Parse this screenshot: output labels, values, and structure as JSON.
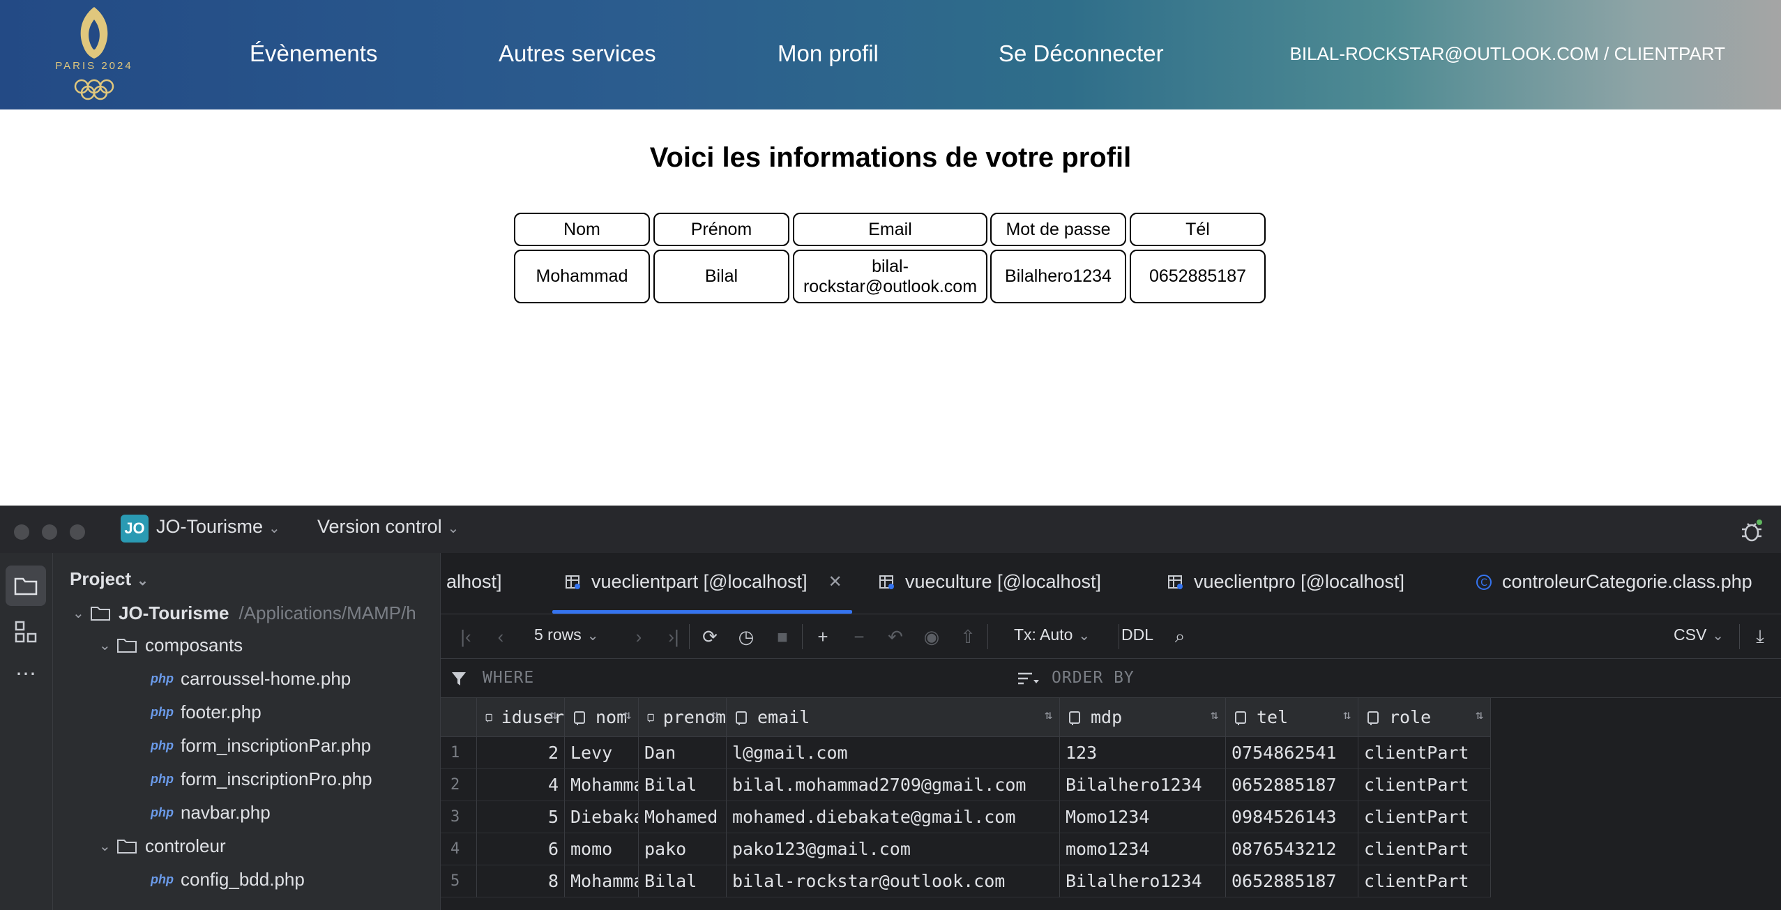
{
  "site": {
    "logo_text": "PARIS 2024",
    "nav": [
      {
        "label": "Évènements"
      },
      {
        "label": "Autres services"
      },
      {
        "label": "Mon profil"
      },
      {
        "label": "Se Déconnecter"
      }
    ],
    "user_label": "BILAL-ROCKSTAR@OUTLOOK.COM / CLIENTPART"
  },
  "profile": {
    "title": "Voici les informations de votre profil",
    "headers": [
      "Nom",
      "Prénom",
      "Email",
      "Mot de passe",
      "Tél"
    ],
    "values": [
      "Mohammad",
      "Bilal",
      "bilal-\nrockstar@outlook.com",
      "Bilalhero1234",
      "0652885187"
    ]
  },
  "ide": {
    "project_badge": "JO",
    "project_name": "JO-Tourisme",
    "version_control": "Version control",
    "panel_title": "Project",
    "tree": {
      "root": {
        "label": "JO-Tourisme",
        "path": "/Applications/MAMP/h"
      },
      "composants": {
        "label": "composants",
        "files": [
          "carroussel-home.php",
          "footer.php",
          "form_inscriptionPar.php",
          "form_inscriptionPro.php",
          "navbar.php"
        ]
      },
      "controleur": {
        "label": "controleur",
        "files": [
          "config_bdd.php"
        ]
      },
      "php_badge": "php"
    },
    "tabs": [
      {
        "label": "alhost]"
      },
      {
        "label": "vueclientpart [@localhost]"
      },
      {
        "label": "vueculture [@localhost]"
      },
      {
        "label": "vueclientpro [@localhost]"
      },
      {
        "label": "controleurCategorie.class.php"
      }
    ],
    "toolbar": {
      "rows": "5 rows",
      "tx": "Tx: Auto",
      "ddl": "DDL",
      "export": "CSV"
    },
    "filter": {
      "where": "WHERE",
      "order_by": "ORDER BY"
    },
    "grid": {
      "columns": [
        "iduser",
        "nom",
        "prenom",
        "email",
        "mdp",
        "tel",
        "role"
      ],
      "rows": [
        {
          "n": "1",
          "cells": [
            "2",
            "Levy",
            "Dan",
            "l@gmail.com",
            "123",
            "0754862541",
            "clientPart"
          ]
        },
        {
          "n": "2",
          "cells": [
            "4",
            "Mohammad",
            "Bilal",
            "bilal.mohammad2709@gmail.com",
            "Bilalhero1234",
            "0652885187",
            "clientPart"
          ]
        },
        {
          "n": "3",
          "cells": [
            "5",
            "Diebakate",
            "Mohamed",
            "mohamed.diebakate@gmail.com",
            "Momo1234",
            "0984526143",
            "clientPart"
          ]
        },
        {
          "n": "4",
          "cells": [
            "6",
            "momo",
            "pako",
            "pako123@gmail.com",
            "momo1234",
            "0876543212",
            "clientPart"
          ]
        },
        {
          "n": "5",
          "cells": [
            "8",
            "Mohammad",
            "Bilal",
            "bilal-rockstar@outlook.com",
            "Bilalhero1234",
            "0652885187",
            "clientPart"
          ]
        }
      ]
    }
  }
}
